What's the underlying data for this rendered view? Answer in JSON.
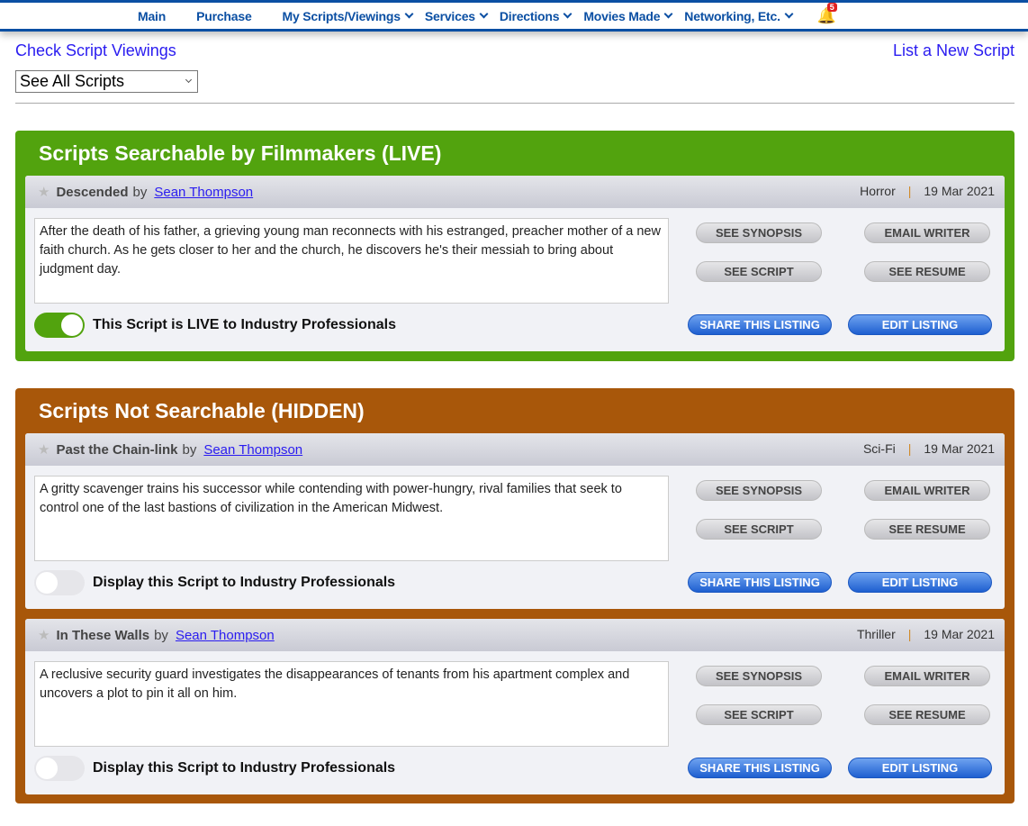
{
  "nav": {
    "items": [
      {
        "label": "Main"
      },
      {
        "label": "Purchase"
      },
      {
        "label": "My Scripts/Viewings"
      },
      {
        "label": "Services"
      },
      {
        "label": "Directions"
      },
      {
        "label": "Movies Made"
      },
      {
        "label": "Networking, Etc."
      }
    ],
    "notifications": "5"
  },
  "links": {
    "check": "Check Script Viewings",
    "new": "List a New Script"
  },
  "filter": {
    "value": "See All Scripts"
  },
  "colors": {
    "live": "#52a30e",
    "hidden": "#a8570a",
    "nav": "#0b4fa3"
  },
  "buttons": {
    "synopsis": "SEE SYNOPSIS",
    "email": "EMAIL WRITER",
    "script": "SEE SCRIPT",
    "resume": "SEE RESUME",
    "share": "SHARE THIS LISTING",
    "edit": "EDIT LISTING"
  },
  "by": "by",
  "live": {
    "title": "Scripts Searchable by Filmmakers (LIVE)",
    "scripts": [
      {
        "title": "Descended",
        "author": "Sean Thompson",
        "genre": "Horror",
        "date": "19 Mar 2021",
        "description": "After the death of his father, a grieving young man reconnects with his estranged, preacher mother of a new faith church. As he gets closer to her and the church, he discovers he's their messiah to bring about judgment day.",
        "toggle_label": "This Script is LIVE to Industry Professionals",
        "live": true
      }
    ]
  },
  "hidden": {
    "title": "Scripts Not Searchable (HIDDEN)",
    "scripts": [
      {
        "title": "Past the Chain-link",
        "author": "Sean Thompson",
        "genre": "Sci-Fi",
        "date": "19 Mar 2021",
        "description": "A gritty scavenger trains his successor while contending with power-hungry, rival families that seek to control one of the last bastions of civilization in the American Midwest.",
        "toggle_label": "Display this Script to Industry Professionals",
        "live": false
      },
      {
        "title": "In These Walls",
        "author": "Sean Thompson",
        "genre": "Thriller",
        "date": "19 Mar 2021",
        "description": "A reclusive security guard investigates the disappearances of tenants from his apartment complex and uncovers a plot to pin it all on him.",
        "toggle_label": "Display this Script to Industry Professionals",
        "live": false
      }
    ]
  }
}
